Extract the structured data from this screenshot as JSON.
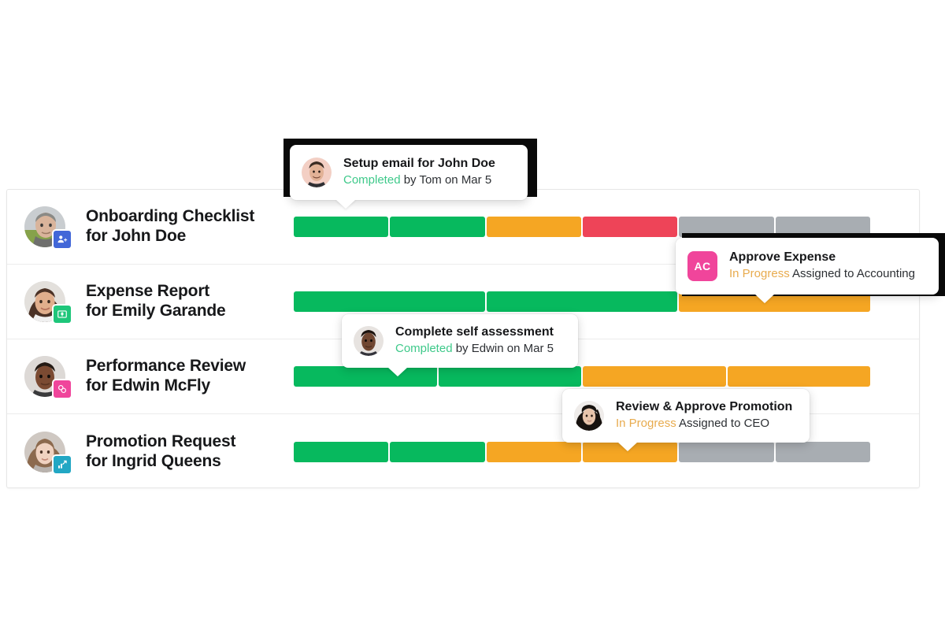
{
  "palette": {
    "green": "#07b95e",
    "orange": "#f5a623",
    "red": "#ee4458",
    "gray": "#a8adb2",
    "completed_text": "#3ec98a",
    "inprogress_text": "#e8ab4e",
    "badge_blue": "#4267d8",
    "badge_green": "#1ec67a",
    "badge_pink": "#f0459b",
    "badge_teal": "#22a7c4",
    "tip_square_pink": "#f0459b"
  },
  "rows": [
    {
      "title_line1": "Onboarding Checklist",
      "title_line2": "for John Doe",
      "badge_icon": "user-plus-icon",
      "badge_color": "#4267d8",
      "avatar_name": "avatar-john-doe",
      "segments": [
        {
          "state": "green",
          "span": 1
        },
        {
          "state": "green",
          "span": 1
        },
        {
          "state": "orange",
          "span": 1
        },
        {
          "state": "red",
          "span": 1
        },
        {
          "state": "gray",
          "span": 1
        },
        {
          "state": "gray",
          "span": 1
        }
      ]
    },
    {
      "title_line1": "Expense Report",
      "title_line2": "for Emily Garande",
      "badge_icon": "money-icon",
      "badge_color": "#1ec67a",
      "avatar_name": "avatar-emily-garande",
      "segments": [
        {
          "state": "green",
          "span": 2
        },
        {
          "state": "green",
          "span": 2
        },
        {
          "state": "orange",
          "span": 2
        }
      ]
    },
    {
      "title_line1": "Performance Review",
      "title_line2": "for Edwin McFly",
      "badge_icon": "rings-icon",
      "badge_color": "#f0459b",
      "avatar_name": "avatar-edwin-mcfly",
      "segments": [
        {
          "state": "green",
          "span": 1.5
        },
        {
          "state": "green",
          "span": 1.5
        },
        {
          "state": "orange",
          "span": 1.5
        },
        {
          "state": "orange",
          "span": 1.5
        }
      ]
    },
    {
      "title_line1": "Promotion Request",
      "title_line2": "for Ingrid Queens",
      "badge_icon": "chart-arrow-icon",
      "badge_color": "#22a7c4",
      "avatar_name": "avatar-ingrid-queens",
      "segments": [
        {
          "state": "green",
          "span": 1
        },
        {
          "state": "green",
          "span": 1
        },
        {
          "state": "orange",
          "span": 1
        },
        {
          "state": "orange",
          "span": 1
        },
        {
          "state": "gray",
          "span": 1
        },
        {
          "state": "gray",
          "span": 1
        }
      ]
    }
  ],
  "tooltips": [
    {
      "id": "setup-email",
      "title": "Setup email for John Doe",
      "status": "Completed",
      "status_kind": "completed",
      "detail": "by Tom on Mar 5",
      "avatar_kind": "photo",
      "avatar_name": "avatar-tom",
      "highlighted": true
    },
    {
      "id": "approve-expense",
      "title": "Approve Expense",
      "status": "In Progress",
      "status_kind": "inprogress",
      "detail": "Assigned to Accounting",
      "avatar_kind": "initials",
      "avatar_initials": "AC",
      "avatar_name": "avatar-accounting",
      "highlighted": true
    },
    {
      "id": "complete-self-assessment",
      "title": "Complete self assessment",
      "status": "Completed",
      "status_kind": "completed",
      "detail": "by Edwin on Mar 5",
      "avatar_kind": "photo",
      "avatar_name": "avatar-edwin",
      "highlighted": false
    },
    {
      "id": "review-approve-promotion",
      "title": "Review & Approve Promotion",
      "status": "In Progress",
      "status_kind": "inprogress",
      "detail": "Assigned to CEO",
      "avatar_kind": "photo",
      "avatar_name": "avatar-ceo",
      "highlighted": false
    }
  ]
}
